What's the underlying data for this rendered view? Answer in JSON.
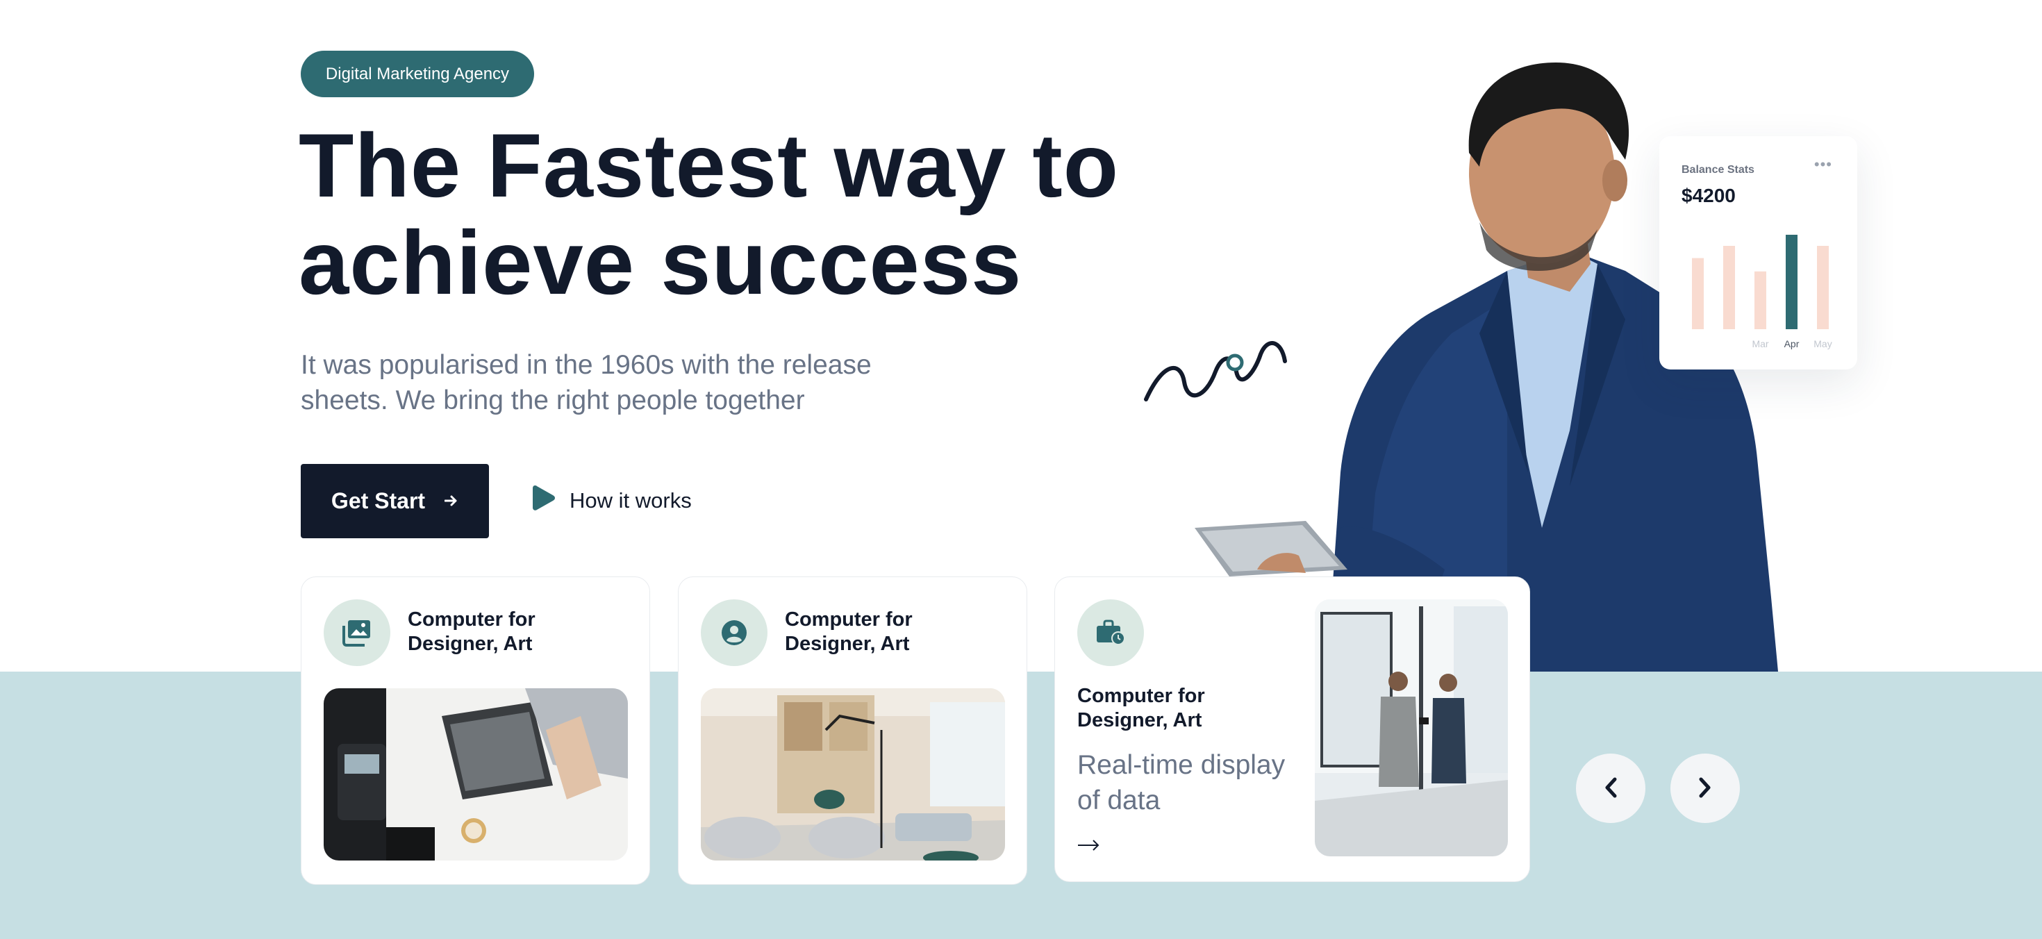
{
  "hero": {
    "badge": "Digital Marketing Agency",
    "headline_line1": "The Fastest way to",
    "headline_line2": "achieve success",
    "subtext_line1": "It was popularised in the 1960s with the release",
    "subtext_line2": "sheets. We bring the right people together",
    "cta_label": "Get Start",
    "cta_icon": "arrow-right-icon",
    "secondary_label": "How it works",
    "secondary_icon": "play-icon"
  },
  "stats_card": {
    "title": "Balance Stats",
    "value": "$4200",
    "menu_icon": "more-dots-icon",
    "chart_data": {
      "type": "bar",
      "categories": [
        "",
        "",
        "Mar",
        "Apr",
        "May"
      ],
      "values": [
        64,
        75,
        52,
        85,
        75
      ],
      "highlight": "Apr",
      "colors": {
        "normal": "#f9dbd0",
        "highlight": "#2e6b72"
      }
    }
  },
  "cards": [
    {
      "title_line1": "Computer for",
      "title_line2": "Designer, Art",
      "icon": "photo-library-icon"
    },
    {
      "title_line1": "Computer for",
      "title_line2": "Designer, Art",
      "icon": "user-circle-icon"
    },
    {
      "title_line1": "Computer for",
      "title_line2": "Designer, Art",
      "icon": "briefcase-clock-icon",
      "desc_line1": "Real-time display",
      "desc_line2": "of data",
      "link_icon": "arrow-right-icon"
    }
  ],
  "carousel": {
    "prev_icon": "chevron-left-icon",
    "next_icon": "chevron-right-icon"
  },
  "colors": {
    "primary": "#2e6b72",
    "dark": "#121a2b",
    "band": "#c6dfe3",
    "muted_text": "#687386",
    "icon_bg": "#dbe9e3",
    "bar_light": "#f9dbd0"
  }
}
